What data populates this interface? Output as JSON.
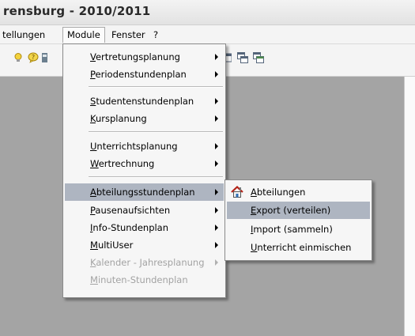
{
  "window": {
    "title": "rensburg  -  2010/2011"
  },
  "menubar": {
    "items": [
      {
        "label": "tellungen"
      },
      {
        "label": "Module"
      },
      {
        "label": "Fenster"
      },
      {
        "label": "?"
      }
    ]
  },
  "toolbar": {
    "icons": [
      "bulb-icon",
      "help-bubble-icon",
      "partial-toolbar-icon",
      "window-icon-1",
      "window-icon-2",
      "window-icon-3"
    ]
  },
  "module_menu": {
    "items": [
      {
        "label": "Vertretungsplanung",
        "mnemonic": "V",
        "submenu": true,
        "enabled": true
      },
      {
        "label": "Periodenstundenplan",
        "mnemonic": "P",
        "submenu": true,
        "enabled": true
      },
      {
        "label": "Studentenstundenplan",
        "mnemonic": "S",
        "submenu": true,
        "enabled": true
      },
      {
        "label": "Kursplanung",
        "mnemonic": "K",
        "submenu": true,
        "enabled": true
      },
      {
        "label": "Unterrichtsplanung",
        "mnemonic": "U",
        "submenu": true,
        "enabled": true
      },
      {
        "label": "Wertrechnung",
        "mnemonic": "W",
        "submenu": true,
        "enabled": true
      },
      {
        "label": "Abteilungsstundenplan",
        "mnemonic": "A",
        "submenu": true,
        "enabled": true,
        "selected": true
      },
      {
        "label": "Pausenaufsichten",
        "mnemonic": "P",
        "submenu": true,
        "enabled": true
      },
      {
        "label": "Info-Stundenplan",
        "mnemonic": "I",
        "submenu": true,
        "enabled": true
      },
      {
        "label": "MultiUser",
        "mnemonic": "M",
        "submenu": true,
        "enabled": true
      },
      {
        "label": "Kalender - Jahresplanung",
        "mnemonic": "K",
        "submenu": true,
        "enabled": false
      },
      {
        "label": "Minuten-Stundenplan",
        "mnemonic": "M",
        "submenu": false,
        "enabled": false
      }
    ]
  },
  "abteilung_submenu": {
    "items": [
      {
        "label": "Abteilungen",
        "mnemonic": "A",
        "icon": "house-icon"
      },
      {
        "label": "Export (verteilen)",
        "mnemonic": "E",
        "selected": true
      },
      {
        "label": "Import (sammeln)",
        "mnemonic": "I"
      },
      {
        "label": "Unterricht einmischen",
        "mnemonic": "U"
      }
    ]
  },
  "colors": {
    "workspace": "#a4a4a4",
    "menu_bg": "#f6f6f6",
    "highlight": "#aeb5c1",
    "disabled_text": "#a3a3a3"
  }
}
